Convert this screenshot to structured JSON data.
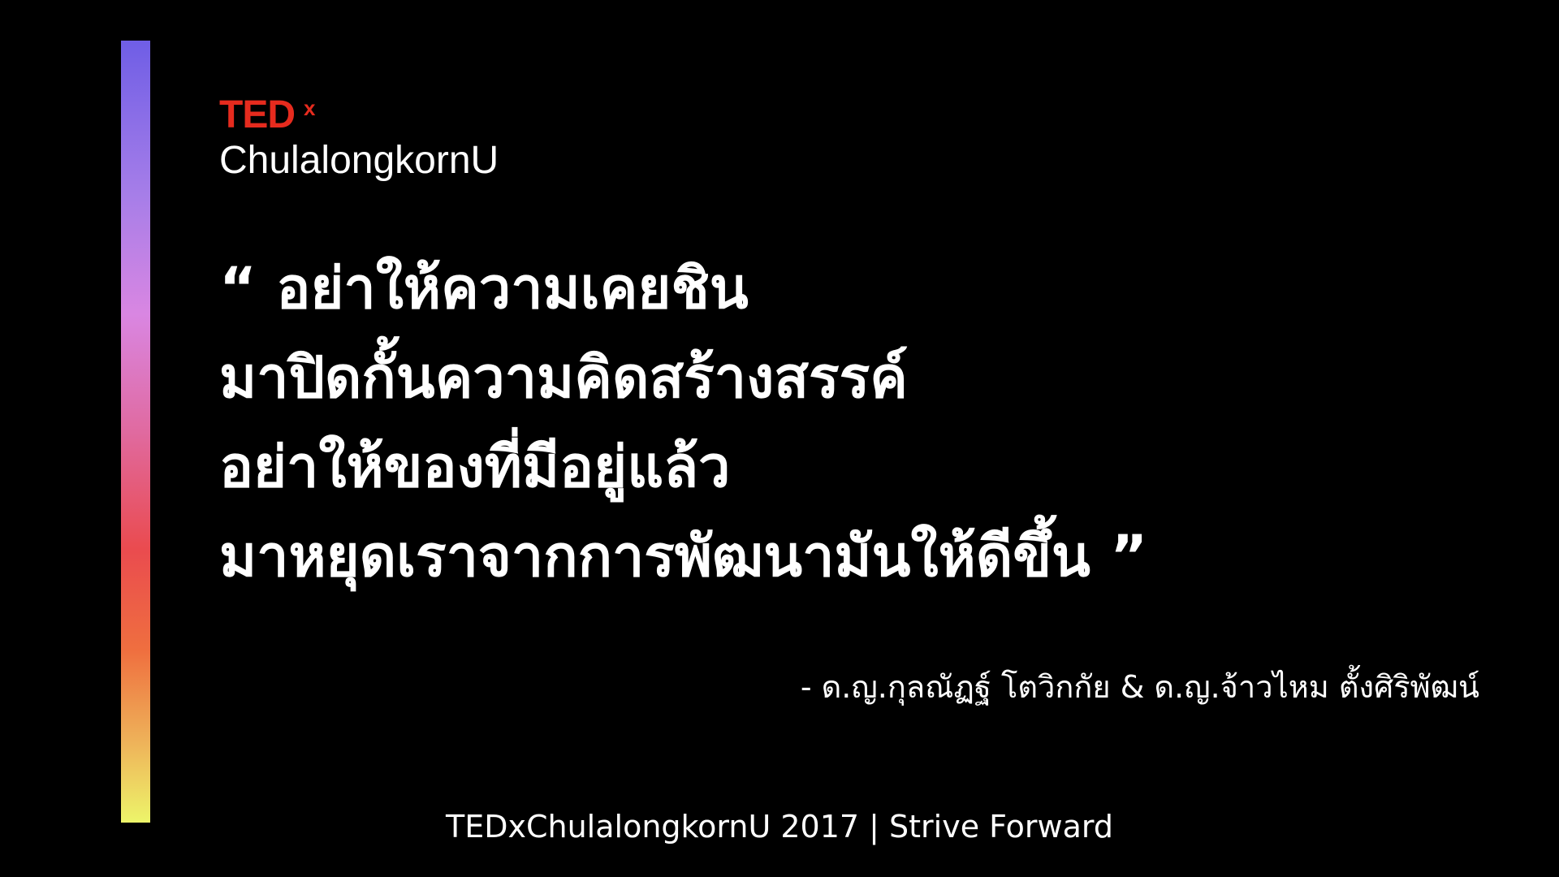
{
  "logo": {
    "ted": "TED",
    "x": "x",
    "name": "ChulalongkornU",
    "color": "#e62b1e"
  },
  "quote": {
    "lines": [
      "“ อย่าให้ความเคยชิน",
      "มาปิดกั้นความคิดสร้างสรรค์",
      "อย่าให้ของที่มีอยู่แล้ว",
      "มาหยุดเราจากการพัฒนามันให้ดีขึ้น ”"
    ]
  },
  "attribution": "- ด.ญ.กุลณัฏฐ์ โตวิกกัย & ด.ญ.จ้าวไหม ตั้งศิริพัฒน์",
  "footer": "TEDxChulalongkornU 2017 | Strive Forward",
  "colors": {
    "background": "#000000",
    "text": "#ffffff",
    "gradient": [
      "#6f5ee6",
      "#d986e2",
      "#ea4b4f",
      "#edf56a"
    ]
  }
}
